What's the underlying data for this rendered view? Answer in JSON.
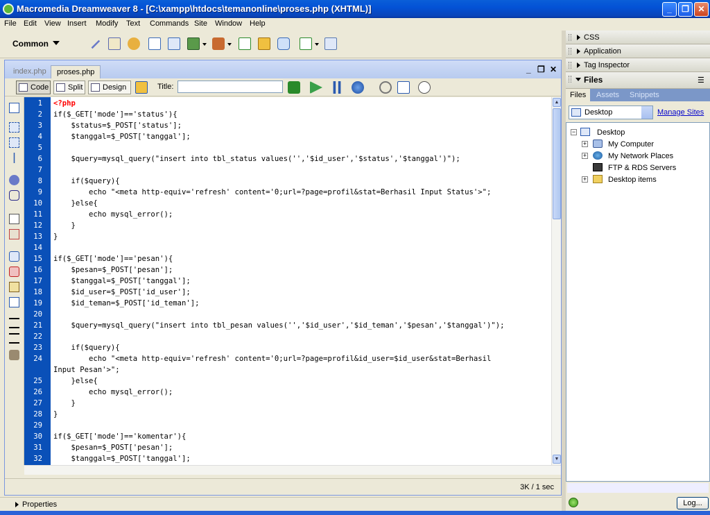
{
  "window": {
    "title": "Macromedia Dreamweaver 8 - [C:\\xampp\\htdocs\\temanonline\\proses.php (XHTML)]",
    "minimize": "_",
    "restore": "❐",
    "close": "✕"
  },
  "menu": [
    "File",
    "Edit",
    "View",
    "Insert",
    "Modify",
    "Text",
    "Commands",
    "Site",
    "Window",
    "Help"
  ],
  "insert_bar": {
    "category": "Common"
  },
  "document": {
    "tabs": [
      {
        "label": "index.php",
        "active": false
      },
      {
        "label": "proses.php",
        "active": true
      }
    ],
    "view_buttons": {
      "code": "Code",
      "split": "Split",
      "design": "Design"
    },
    "title_label": "Title:",
    "title_value": "",
    "status": "3K / 1 sec",
    "doc_minimize": "_",
    "doc_restore": "❐",
    "doc_close": "✕"
  },
  "code_lines": [
    {
      "n": "1",
      "text": "<?php",
      "style": "php-tag"
    },
    {
      "n": "2",
      "text": "if($_GET['mode']=='status'){"
    },
    {
      "n": "3",
      "text": "    $status=$_POST['status'];"
    },
    {
      "n": "4",
      "text": "    $tanggal=$_POST['tanggal'];"
    },
    {
      "n": "5",
      "text": ""
    },
    {
      "n": "6",
      "text": "    $query=mysql_query(\"insert into tbl_status values('','$id_user','$status','$tanggal')\");"
    },
    {
      "n": "7",
      "text": ""
    },
    {
      "n": "8",
      "text": "    if($query){"
    },
    {
      "n": "9",
      "text": "        echo \"<meta http-equiv='refresh' content='0;url=?page=profil&stat=Berhasil Input Status'>\";"
    },
    {
      "n": "10",
      "text": "    }else{"
    },
    {
      "n": "11",
      "text": "        echo mysql_error();"
    },
    {
      "n": "12",
      "text": "    }"
    },
    {
      "n": "13",
      "text": "}"
    },
    {
      "n": "14",
      "text": ""
    },
    {
      "n": "15",
      "text": "if($_GET['mode']=='pesan'){"
    },
    {
      "n": "16",
      "text": "    $pesan=$_POST['pesan'];"
    },
    {
      "n": "17",
      "text": "    $tanggal=$_POST['tanggal'];"
    },
    {
      "n": "18",
      "text": "    $id_user=$_POST['id_user'];"
    },
    {
      "n": "19",
      "text": "    $id_teman=$_POST['id_teman'];"
    },
    {
      "n": "20",
      "text": ""
    },
    {
      "n": "21",
      "text": "    $query=mysql_query(\"insert into tbl_pesan values('','$id_user','$id_teman','$pesan','$tanggal')\");"
    },
    {
      "n": "22",
      "text": ""
    },
    {
      "n": "23",
      "text": "    if($query){"
    },
    {
      "n": "24",
      "text": "        echo \"<meta http-equiv='refresh' content='0;url=?page=profil&id_user=$id_user&stat=Berhasil"
    },
    {
      "n": "",
      "text": "Input Pesan'>\";"
    },
    {
      "n": "25",
      "text": "    }else{"
    },
    {
      "n": "26",
      "text": "        echo mysql_error();"
    },
    {
      "n": "27",
      "text": "    }"
    },
    {
      "n": "28",
      "text": "}"
    },
    {
      "n": "29",
      "text": ""
    },
    {
      "n": "30",
      "text": "if($_GET['mode']=='komentar'){"
    },
    {
      "n": "31",
      "text": "    $pesan=$_POST['pesan'];"
    },
    {
      "n": "32",
      "text": "    $tanggal=$_POST['tanggal'];"
    }
  ],
  "properties_label": "Properties",
  "panels": {
    "css": "CSS",
    "application": "Application",
    "tag_inspector": "Tag Inspector",
    "files": "Files",
    "files_tabs": [
      "Files",
      "Assets",
      "Snippets"
    ],
    "site": "Desktop",
    "manage_sites": "Manage Sites",
    "tree": [
      {
        "label": "Desktop",
        "level": 0,
        "expander": "−",
        "icon": "desktop-icon"
      },
      {
        "label": "My Computer",
        "level": 1,
        "expander": "+",
        "icon": "computer-icon"
      },
      {
        "label": "My Network Places",
        "level": 1,
        "expander": "+",
        "icon": "network-icon"
      },
      {
        "label": "FTP & RDS Servers",
        "level": 1,
        "expander": "",
        "icon": "server-icon"
      },
      {
        "label": "Desktop items",
        "level": 1,
        "expander": "+",
        "icon": "folder-icon"
      }
    ],
    "log_button": "Log..."
  }
}
